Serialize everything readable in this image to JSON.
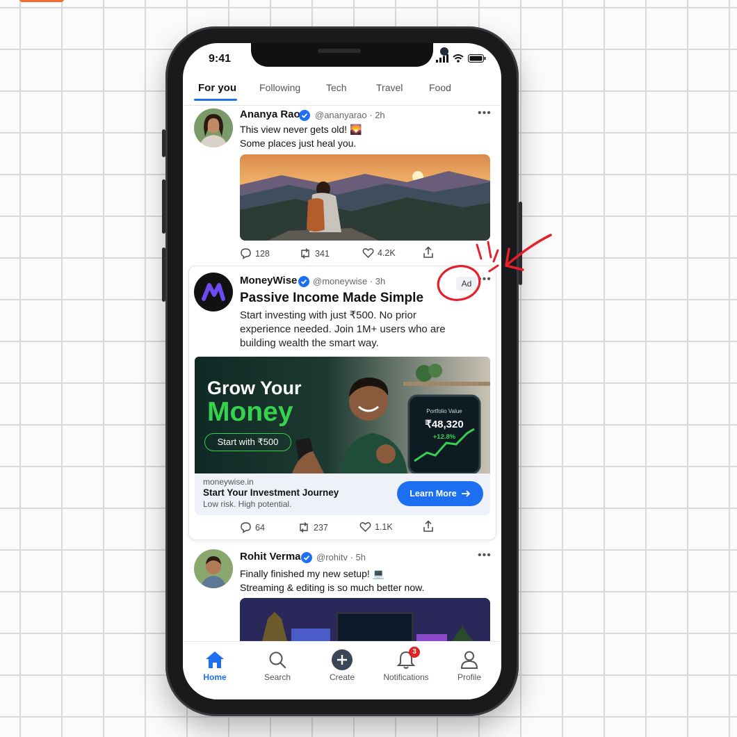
{
  "status": {
    "time": "9:41"
  },
  "tabs": [
    "For you",
    "Following",
    "Tech",
    "Travel",
    "Food"
  ],
  "posts": [
    {
      "name": "Ananya Rao",
      "handle": "@ananyarao · 2h",
      "line1": "This view never gets old! 🌄",
      "line2": "Some places just heal you.",
      "replies": "128",
      "reposts": "341",
      "likes": "4.2K"
    },
    {
      "name": "Rohit Verma",
      "handle": "@rohitv · 5h",
      "line1": "Finally finished my new setup! 💻",
      "line2": "Streaming & editing is so much better now."
    }
  ],
  "ad": {
    "name": "MoneyWise",
    "handle": "@moneywise · 3h",
    "badge": "Ad",
    "title": "Passive Income Made Simple",
    "text": "Start investing with just ₹500. No prior experience needed. Join 1M+ users who are building wealth the smart way.",
    "banner_line1": "Grow Your",
    "banner_line2": "Money",
    "banner_cta": "Start with ₹500",
    "phone_label": "Portfolio Value",
    "phone_value": "₹48,320",
    "phone_change": "+12.8%",
    "domain": "moneywise.in",
    "link_title": "Start Your Investment Journey",
    "link_sub": "Low risk. High potential.",
    "button": "Learn More",
    "replies": "64",
    "reposts": "237",
    "likes": "1.1K"
  },
  "nav": {
    "home": "Home",
    "search": "Search",
    "create": "Create",
    "notifications": "Notifications",
    "notifications_count": "3",
    "profile": "Profile"
  },
  "colors": {
    "accent": "#1d6ff2",
    "annotation": "#e4202a",
    "ad_green": "#35d14f"
  },
  "icons": [
    "reply-icon",
    "repost-icon",
    "like-icon",
    "share-icon",
    "home-icon",
    "search-icon",
    "plus-icon",
    "bell-icon",
    "profile-icon",
    "verified-icon"
  ]
}
